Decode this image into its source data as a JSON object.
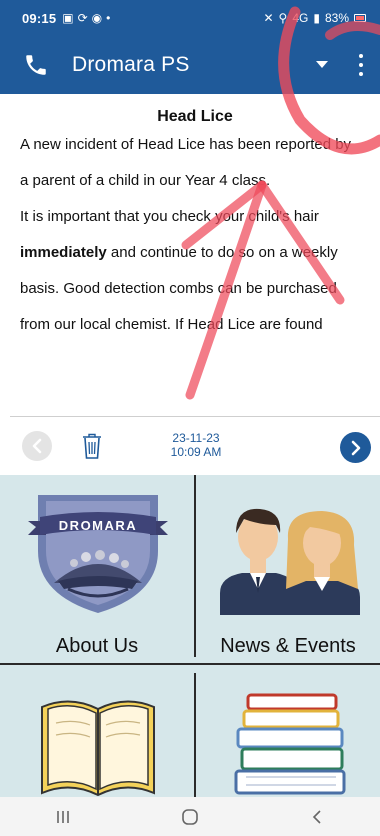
{
  "status_bar": {
    "time": "09:15",
    "signal_text": "4G",
    "battery": "83%"
  },
  "app_bar": {
    "title": "Dromara PS"
  },
  "notice": {
    "title": "Head Lice",
    "paragraphs": [
      "A new incident of Head Lice has been reported by",
      "a parent of a child in our Year 4 class.",
      "It is important that you check your child's hair",
      "and continue to do so on a weekly",
      "basis. Good detection combs can be purchased",
      "from our local chemist. If Head Lice are found"
    ],
    "emphasis": "immediately",
    "date": "23-11-23",
    "time": "10:09 AM"
  },
  "tiles": [
    {
      "label": "About Us",
      "badge_text": "DROMARA"
    },
    {
      "label": "News & Events"
    },
    {
      "label": ""
    },
    {
      "label": ""
    }
  ],
  "colors": {
    "brand": "#1f5a9a",
    "tile_bg": "#d6e7ea",
    "annotation": "#ef4a5a"
  },
  "icons": {
    "call": "phone-icon",
    "dropdown": "caret-down-icon",
    "menu": "more-vert-icon",
    "prev": "chevron-left-icon",
    "delete": "trash-icon",
    "next": "chevron-right-icon"
  }
}
